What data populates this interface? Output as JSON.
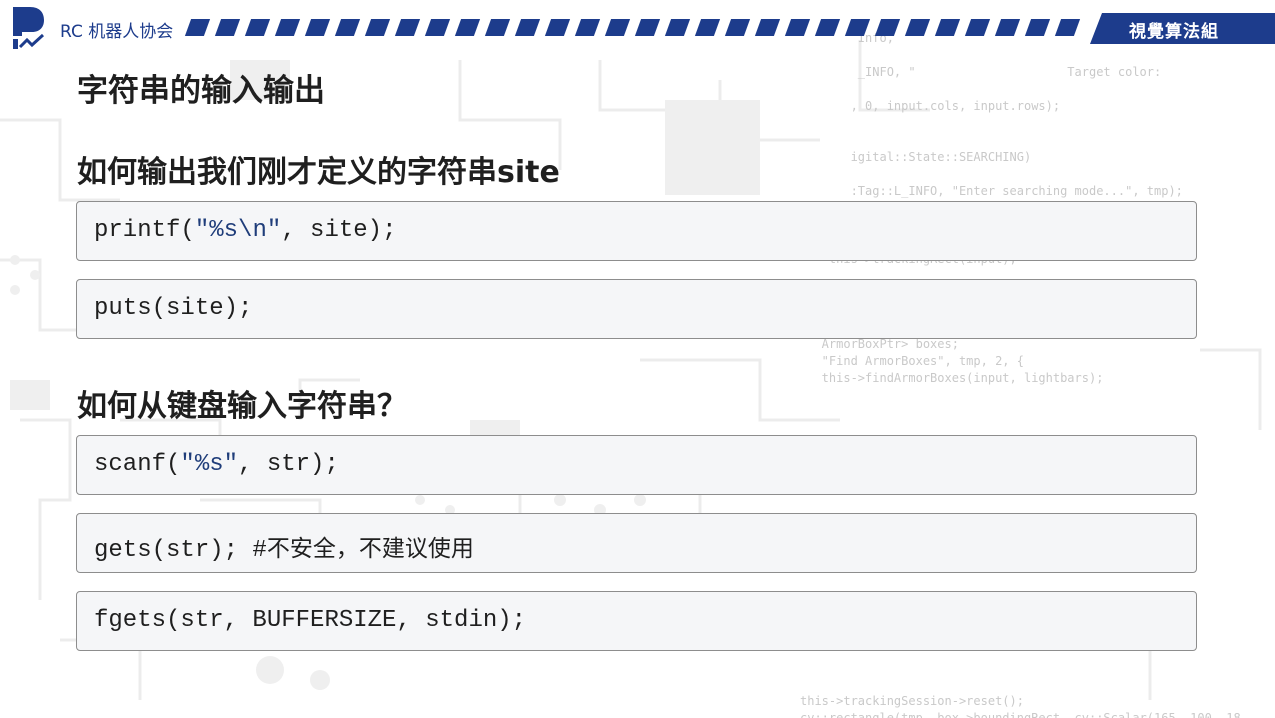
{
  "header": {
    "org_name": "RC 机器人协会",
    "group_label": "視覺算法組",
    "accent_color": "#1d3c8c",
    "logo_icon": "rc-logo-icon"
  },
  "slide": {
    "title": "字符串的输入输出",
    "sections": [
      {
        "heading": "如何输出我们刚才定义的字符串site",
        "code_blocks": [
          {
            "pre": "printf(",
            "str": "\"%s\\n\"",
            "post": ", site);"
          },
          {
            "pre": "puts(site);",
            "str": "",
            "post": ""
          }
        ]
      },
      {
        "heading": "如何从键盘输入字符串？",
        "code_blocks": [
          {
            "pre": "scanf(",
            "str": "\"%s\"",
            "post": ", str);"
          },
          {
            "pre": "gets(str); #",
            "str": "",
            "post": "",
            "comment": "不安全，不建议使用"
          },
          {
            "pre": "fgets(str, BUFFERSIZE, stdin);",
            "str": "",
            "post": ""
          }
        ]
      }
    ]
  }
}
